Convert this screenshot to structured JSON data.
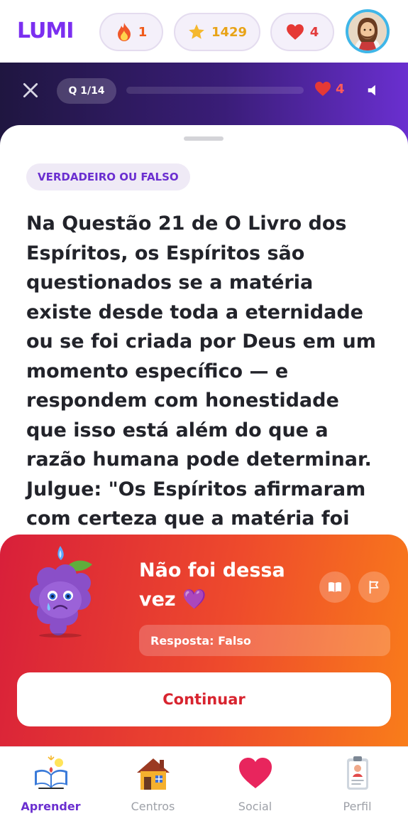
{
  "app": {
    "logo": "LUMI",
    "stats": {
      "streak": "1",
      "stars": "1429",
      "hearts": "4"
    }
  },
  "quiz": {
    "counter": "Q 1/14",
    "progress_fraction": 0.0,
    "hearts": "4",
    "tag": "VERDADEIRO OU FALSO",
    "question": "Na Questão 21 de O Livro dos Espíritos, os Espíritos são questionados se a matéria existe desde toda a eternidade ou se foi criada por Deus em um momento específico — e respondem com honestidade que isso está além do que a razão humana pode determinar. Julgue: \"Os Espíritos afirmaram com certeza que a matéria foi"
  },
  "feedback": {
    "title": "Não foi dessa vez 💜",
    "answer": "Resposta: Falso",
    "continue_label": "Continuar"
  },
  "nav": {
    "items": [
      {
        "label": "Aprender"
      },
      {
        "label": "Centros"
      },
      {
        "label": "Social"
      },
      {
        "label": "Perfil"
      }
    ]
  },
  "colors": {
    "brand": "#7b2ff0",
    "error_gradient_start": "#d81f3a",
    "error_gradient_end": "#f97d1a",
    "header_dark": "#1f1640"
  }
}
